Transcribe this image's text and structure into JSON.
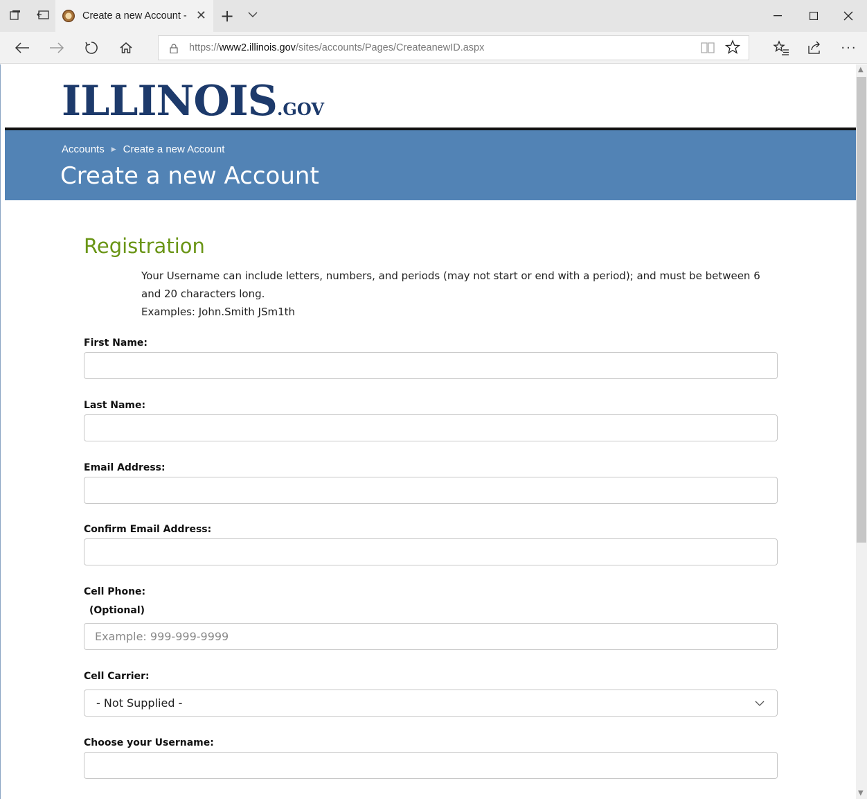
{
  "browser": {
    "tab_title": "Create a new Account -",
    "url_prefix": "https://",
    "url_host": "www2.illinois.gov",
    "url_path": "/sites/accounts/Pages/CreateanewID.aspx"
  },
  "header": {
    "logo_main": "ILLINOIS",
    "logo_suffix": ".GOV"
  },
  "banner": {
    "breadcrumb": [
      "Accounts",
      "Create a new Account"
    ],
    "title": "Create a new Account",
    "color": "#5283b5"
  },
  "registration": {
    "heading": "Registration",
    "heading_color": "#6a9516",
    "intro_line1": "Your Username can include letters, numbers, and periods (may not start or end with a period); and must be between 6 and 20 characters long.",
    "intro_line2": "Examples: John.Smith JSm1th"
  },
  "form": {
    "first_name_label": "First Name:",
    "last_name_label": "Last Name:",
    "email_label": "Email Address:",
    "confirm_email_label": "Confirm Email Address:",
    "cell_phone_label": "Cell Phone:",
    "cell_phone_optional": "(Optional)",
    "cell_phone_placeholder": "Example: 999-999-9999",
    "cell_carrier_label": "Cell Carrier:",
    "cell_carrier_value": "- Not Supplied -",
    "username_label": "Choose your Username:"
  }
}
